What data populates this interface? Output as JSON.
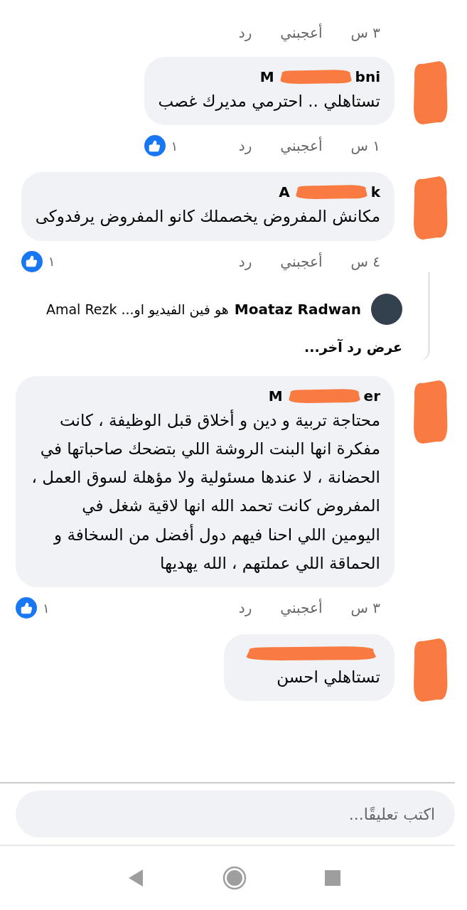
{
  "top_actions": {
    "time": "٣ س",
    "like": "أعجبني",
    "reply": "رد"
  },
  "comments": [
    {
      "name_start": "M",
      "name_end": "bni",
      "redacted": true,
      "text": "تستاهلي .. احترمي مديرك غصب",
      "actions": {
        "time": "١ س",
        "like": "أعجبني",
        "reply": "رد",
        "reaction_count": "١"
      }
    },
    {
      "name_start": "A",
      "name_end": "k",
      "redacted": true,
      "text": "مكانش المفروض يخصملك كانو المفروض يرفدوكى",
      "actions": {
        "time": "٤ س",
        "like": "أعجبني",
        "reply": "رد",
        "reaction_count": "١"
      },
      "replies": [
        {
          "author": "Moataz Radwan",
          "text": "هو فين الفيديو او... Amal Rezk"
        }
      ],
      "more_replies": "عرض رد آخر..."
    },
    {
      "name_start": "M",
      "name_end": "er",
      "redacted": true,
      "text": "محتاجة تربية و دين و أخلاق قبل الوظيفة ، كانت مفكرة انها البنت الروشة اللي بتضحك صاحباتها في الحضانة ، لا عندها مسئولية ولا مؤهلة لسوق العمل ، المفروض كانت تحمد الله انها لاقية شغل في اليومين اللي احنا فيهم دول أفضل من السخافة و الحماقة اللي عملتهم ، الله يهديها",
      "actions": {
        "time": "٣ س",
        "like": "أعجبني",
        "reply": "رد",
        "reaction_count": "١"
      }
    },
    {
      "redacted": true,
      "text": "تستاهلي احسن"
    }
  ],
  "composer": {
    "placeholder": "اكتب تعليقًا..."
  }
}
